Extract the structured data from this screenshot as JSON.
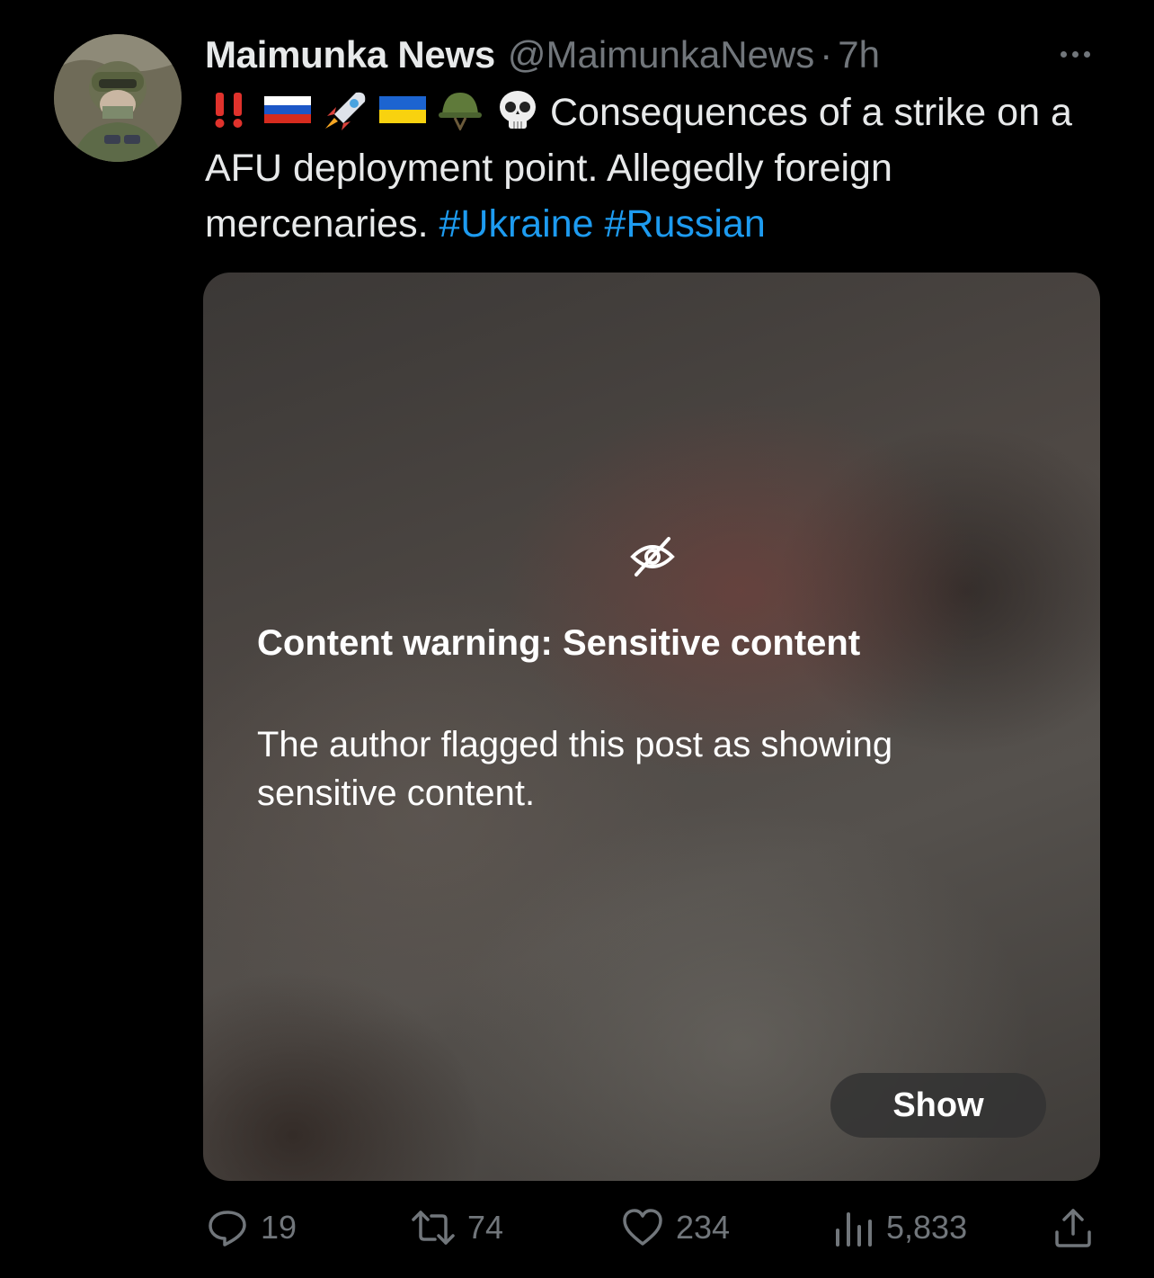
{
  "tweet": {
    "display_name": "Maimunka News",
    "handle": "@MaimunkaNews",
    "separator": "·",
    "time": "7h",
    "emojis": [
      "double-exclamation-emoji",
      "russia-flag-emoji",
      "rocket-emoji",
      "ukraine-flag-emoji",
      "military-helmet-emoji",
      "skull-emoji"
    ],
    "text": "Consequences of a strike on a AFU deployment point. Allegedly foreign mercenaries.",
    "hashtags": [
      "#Ukraine",
      "#Russian"
    ]
  },
  "media": {
    "warning_title": "Content warning: Sensitive content",
    "warning_body": "The author flagged this post as showing sensitive content.",
    "show_label": "Show"
  },
  "actions": {
    "replies": "19",
    "reposts": "74",
    "likes": "234",
    "views": "5,833"
  },
  "colors": {
    "background": "#000000",
    "text": "#e7e9ea",
    "secondary": "#71767b",
    "link": "#1d9bf0"
  }
}
